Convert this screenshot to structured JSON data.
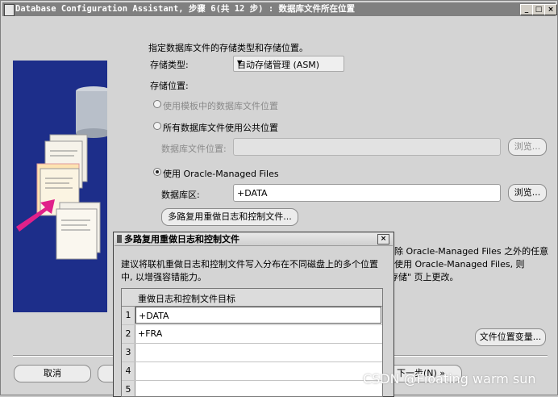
{
  "window": {
    "title": "Database Configuration Assistant, 步骤 6(共 12 步) : 数据库文件所在位置",
    "controls": {
      "minimize": "_",
      "maximize": "□",
      "close": "×"
    }
  },
  "main": {
    "intro": "指定数据库文件的存储类型和存储位置。",
    "storage_type_label": "存储类型:",
    "storage_type_value": "自动存储管理 (ASM)",
    "storage_location_label": "存储位置:",
    "option_template": "使用模板中的数据库文件位置",
    "option_common": "所有数据库文件使用公共位置",
    "db_file_location_label": "数据库文件位置:",
    "db_file_location_value": "",
    "browse_label_1": "浏览...",
    "option_omf": "使用 Oracle-Managed Files",
    "db_area_label": "数据库区:",
    "db_area_value": "+DATA",
    "browse_label_2": "浏览...",
    "multiplex_button": "多路复用重做日志和控制文件...",
    "omf_note_1": "除 Oracle-Managed Files 之外的任意",
    "omf_note_2": "使用 Oracle-Managed Files, 则",
    "omf_note_3": "存储\" 页上更改。",
    "file_location_variables_button": "文件位置变量..."
  },
  "footer": {
    "cancel_label": "取消",
    "next_label": "下一步(N)",
    "next_arrow": "»"
  },
  "dialog": {
    "title": "多路复用重做日志和控制文件",
    "close": "×",
    "description_1": "建议将联机重做日志和控制文件写入分布在不同磁盘上的多个位置",
    "description_2": "中, 以增强容错能力。",
    "column_header": "重做日志和控制文件目标",
    "rows": [
      {
        "num": "1",
        "value": "+DATA"
      },
      {
        "num": "2",
        "value": "+FRA"
      },
      {
        "num": "3",
        "value": ""
      },
      {
        "num": "4",
        "value": ""
      },
      {
        "num": "5",
        "value": ""
      }
    ]
  },
  "watermark": "CSDN @Floating warm sun",
  "colors": {
    "banner": "#1d2e8a",
    "arrow": "#e0218a",
    "titlebar": "#808080"
  }
}
